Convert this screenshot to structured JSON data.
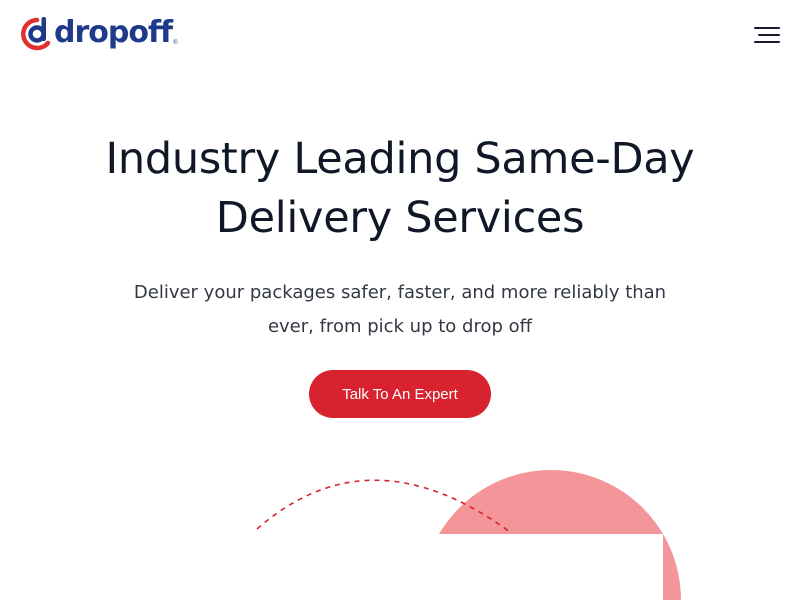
{
  "header": {
    "logo_text": "dropoff",
    "logo_reg": "®",
    "menu_icon": "hamburger-menu-icon"
  },
  "hero": {
    "title": "Industry Leading Same-Day Delivery Services",
    "subtitle": "Deliver your packages safer, faster, and more reliably than ever, from pick up to drop off",
    "cta_label": "Talk To An Expert"
  },
  "colors": {
    "brand_blue": "#1f3a8a",
    "brand_red": "#d9222f",
    "decor_pink": "#f4959a",
    "text_dark": "#101828"
  }
}
